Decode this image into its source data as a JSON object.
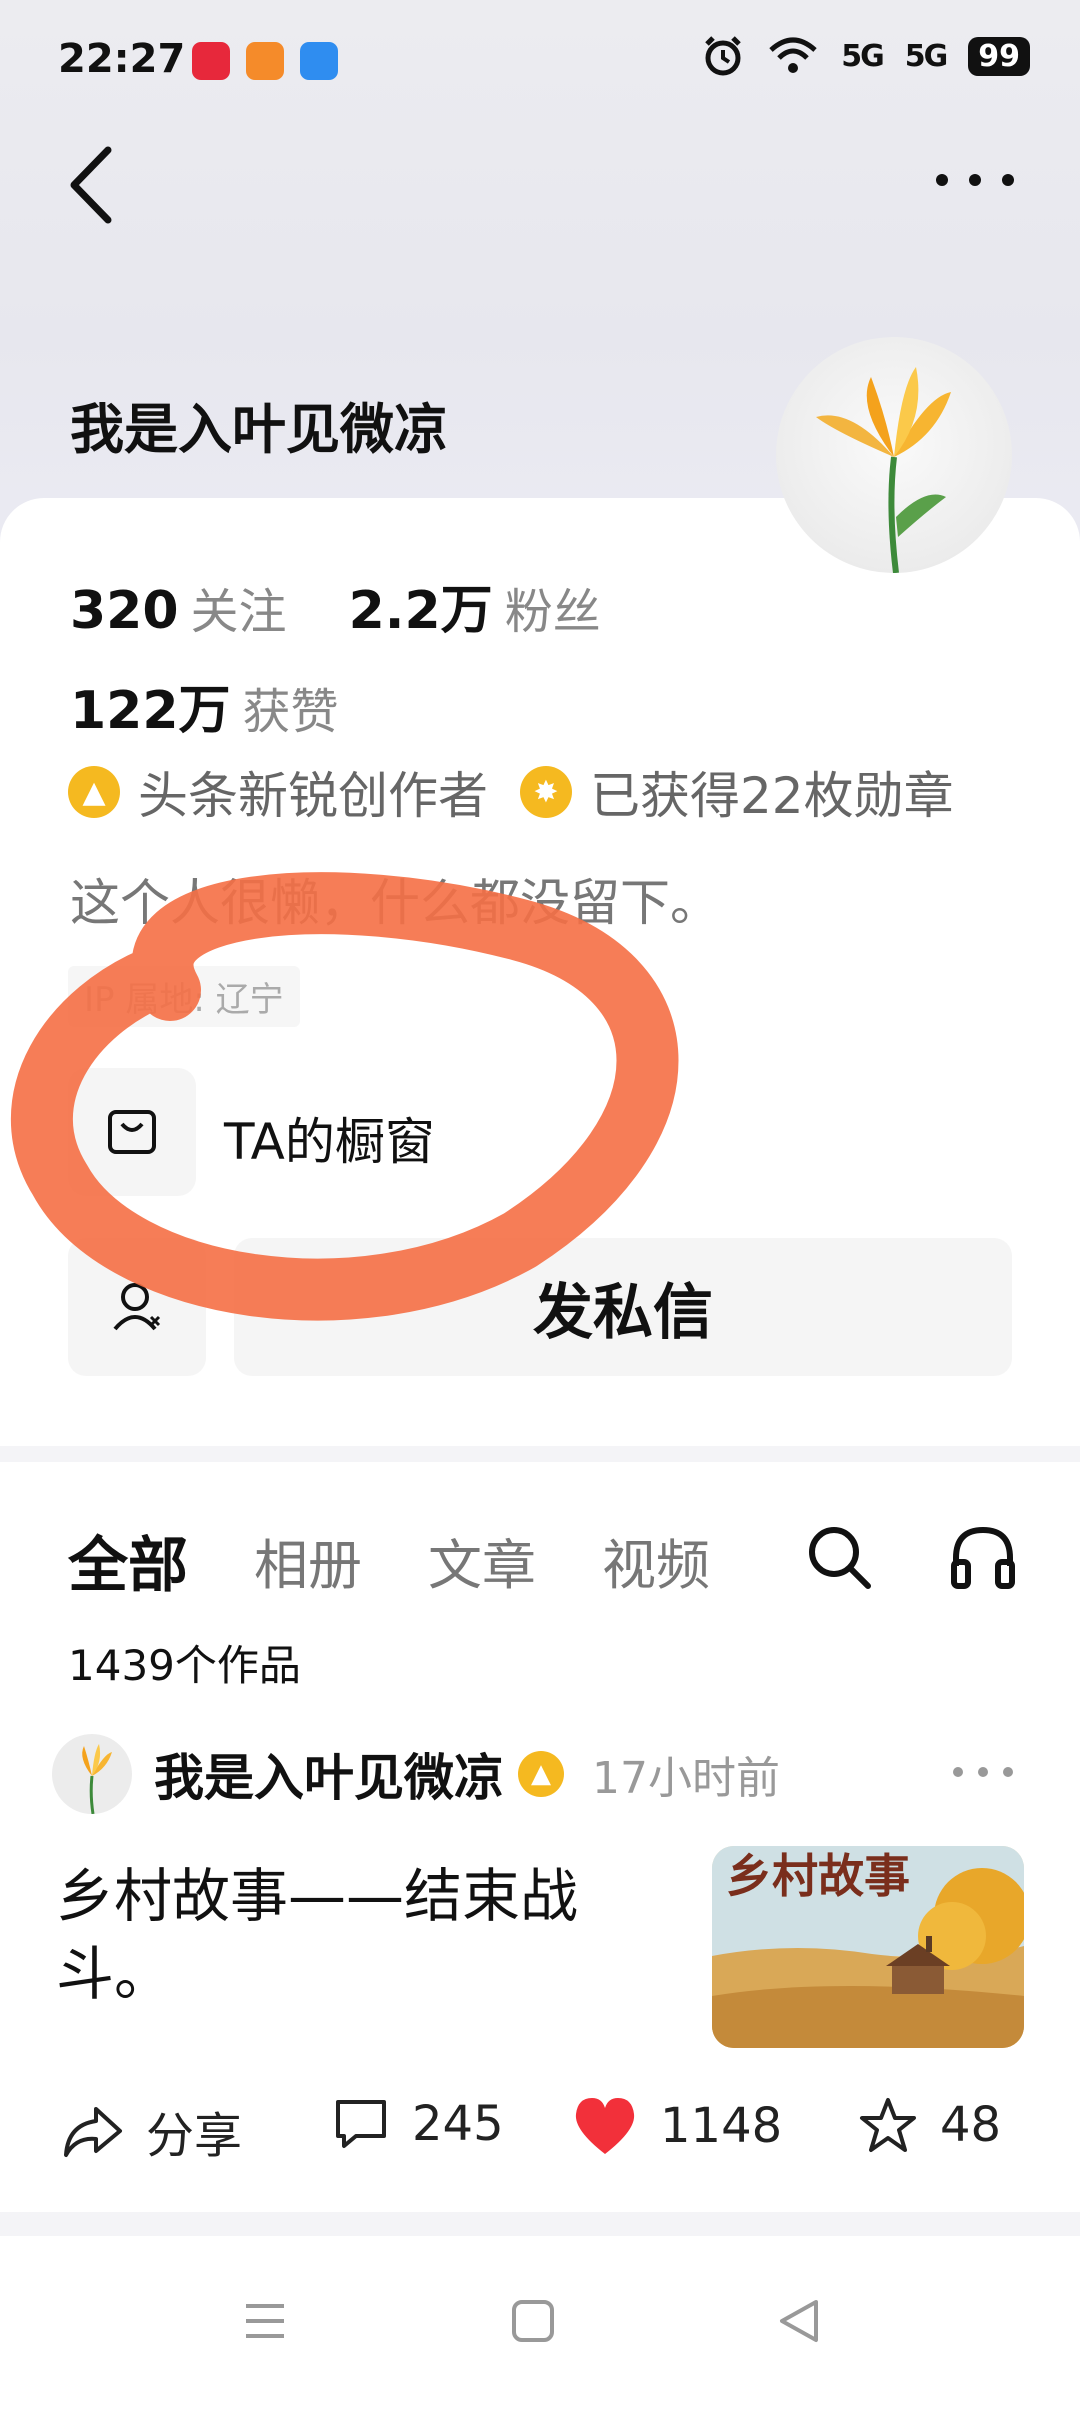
{
  "status_bar": {
    "time": "22:27",
    "signal1": "5G",
    "signal2": "5G",
    "battery": "99"
  },
  "profile": {
    "name": "我是入叶见微凉",
    "following_count": "320",
    "following_label": "关注",
    "fans_count": "2.2万",
    "fans_label": "粉丝",
    "likes_count": "122万",
    "likes_label": "获赞",
    "badge1": "头条新锐创作者",
    "badge2": "已获得22枚勋章",
    "bio": "这个人很懒，什么都没留下。",
    "ip": "IP 属地: 辽宁",
    "shop_label": "TA的橱窗",
    "message_button": "发私信"
  },
  "tabs": [
    {
      "label": "全部",
      "active": true
    },
    {
      "label": "相册"
    },
    {
      "label": "文章"
    },
    {
      "label": "视频"
    }
  ],
  "works_count": "1439个作品",
  "post": {
    "author": "我是入叶见微凉",
    "time": "17小时前",
    "title": "乡村故事——结束战斗。",
    "thumb_text": "乡村故事",
    "share_label": "分享",
    "comments": "245",
    "likes": "1148",
    "favorites": "48"
  },
  "colors": {
    "accent_like": "#f2303a",
    "badge_gold": "#f5b920",
    "annotation": "#f56f45"
  },
  "icons": [
    "back-icon",
    "more-icon",
    "shop-icon",
    "follow-user-icon",
    "search-icon",
    "headphones-icon",
    "share-icon",
    "comment-icon",
    "heart-icon",
    "star-icon",
    "menu-icon",
    "home-icon",
    "back-nav-icon"
  ]
}
